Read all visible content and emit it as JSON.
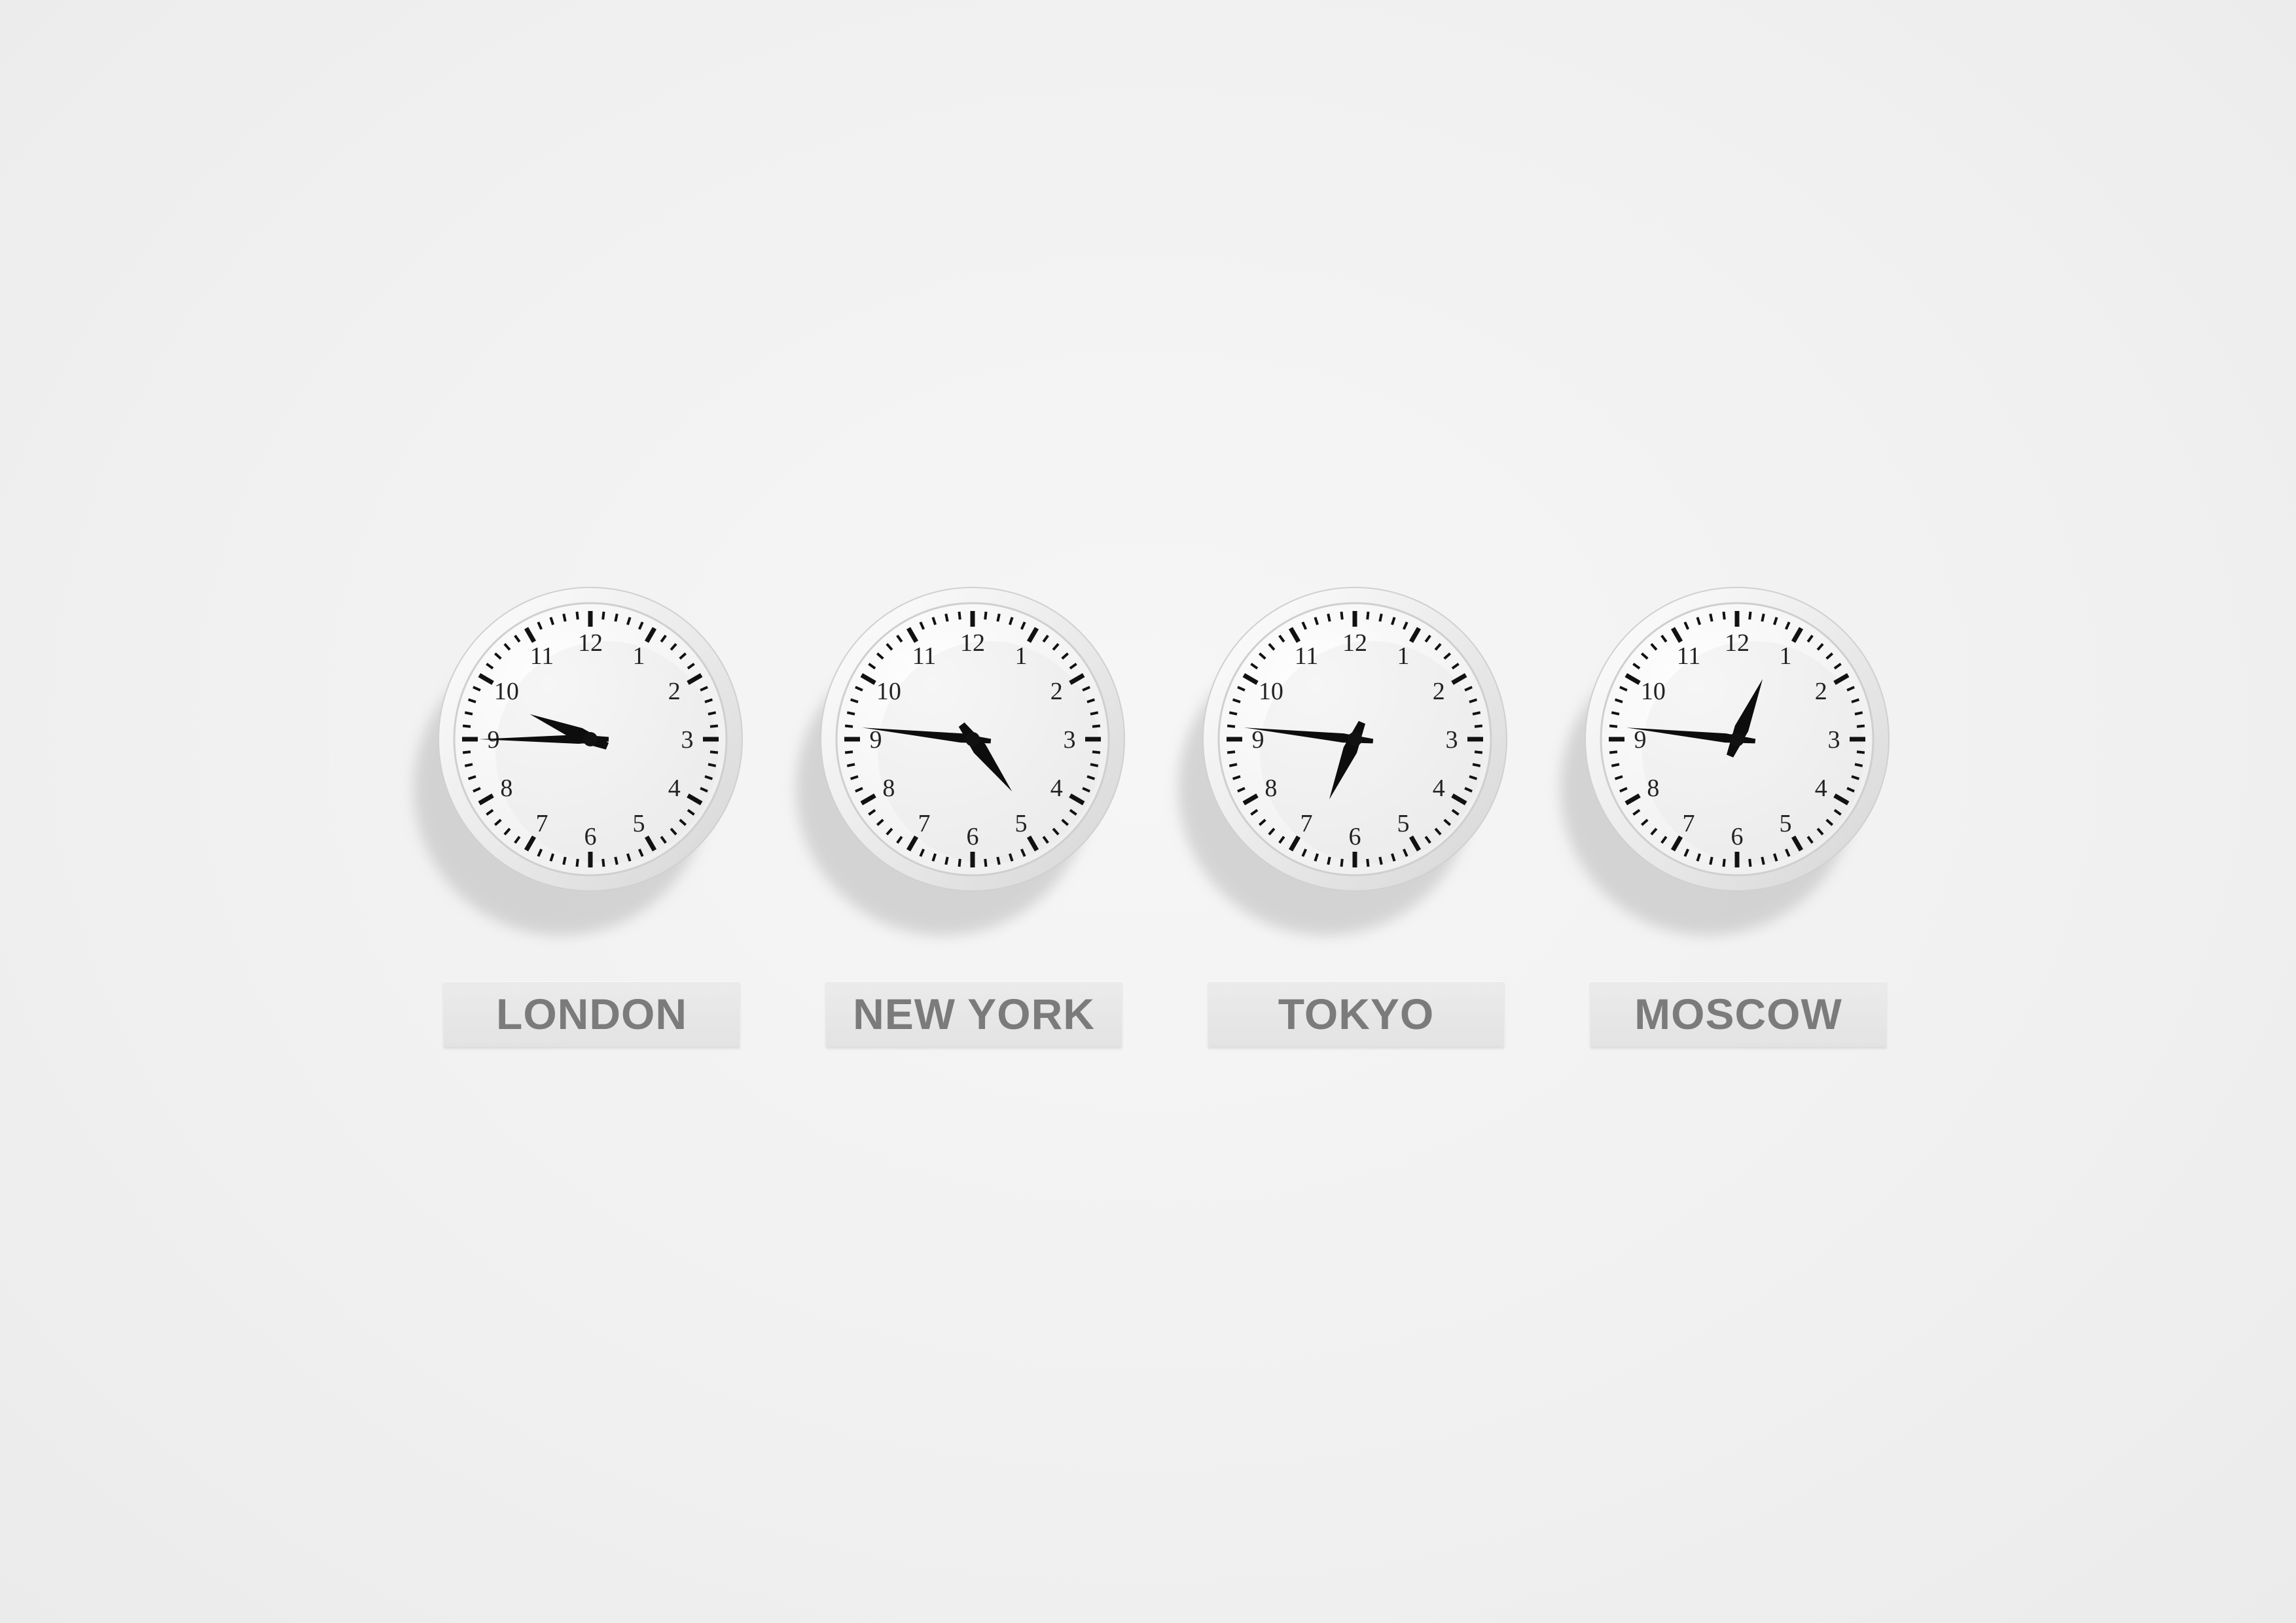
{
  "clocks": [
    {
      "city": "LONDON",
      "hour": 9,
      "minute": 45
    },
    {
      "city": "NEW YORK",
      "hour": 4,
      "minute": 46
    },
    {
      "city": "TOKYO",
      "hour": 6,
      "minute": 46
    },
    {
      "city": "MOSCOW",
      "hour": 12,
      "minute": 46
    }
  ],
  "dial_numbers": [
    "12",
    "1",
    "2",
    "3",
    "4",
    "5",
    "6",
    "7",
    "8",
    "9",
    "10",
    "11"
  ]
}
